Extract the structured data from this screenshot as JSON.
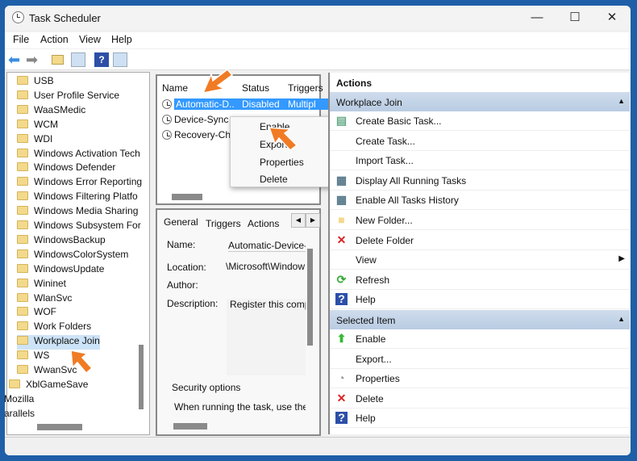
{
  "window": {
    "title": "Task Scheduler",
    "minimize": "—",
    "maximize": "☐",
    "close": "✕"
  },
  "menu": [
    "File",
    "Action",
    "View",
    "Help"
  ],
  "tree": [
    "USB",
    "User Profile Service",
    "WaaSMedic",
    "WCM",
    "WDI",
    "Windows Activation Tech",
    "Windows Defender",
    "Windows Error Reporting",
    "Windows Filtering Platfo",
    "Windows Media Sharing",
    "Windows Subsystem For",
    "WindowsBackup",
    "WindowsColorSystem",
    "WindowsUpdate",
    "Wininet",
    "WlanSvc",
    "WOF",
    "Work Folders",
    "Workplace Join",
    "WS",
    "WwanSvc",
    "XblGameSave",
    "Mozilla",
    "arallels"
  ],
  "tree_selected": "Workplace Join",
  "tasks": {
    "columns": [
      "Name",
      "Status",
      "Triggers"
    ],
    "rows": [
      {
        "name": "Automatic-D...",
        "status": "Disabled",
        "triggers": "Multipl"
      },
      {
        "name": "Device-Sync",
        "status": "",
        "triggers": ""
      },
      {
        "name": "Recovery-Ch",
        "status": "",
        "triggers": ""
      }
    ]
  },
  "context_menu": [
    "Enable",
    "Export...",
    "Properties",
    "Delete"
  ],
  "details": {
    "tabs": [
      "General",
      "Triggers",
      "Actions"
    ],
    "name_label": "Name:",
    "name_value": "Automatic-Device-",
    "location_label": "Location:",
    "location_value": "\\Microsoft\\Window",
    "author_label": "Author:",
    "description_label": "Description:",
    "description_value": "Register this comp",
    "security_label": "Security options",
    "security_text": "When running the task, use the"
  },
  "actions": {
    "title": "Actions",
    "section1": "Workplace Join",
    "items1": [
      {
        "label": "Create Basic Task...",
        "icon": "create-basic-task-icon"
      },
      {
        "label": "Create Task...",
        "icon": "create-task-icon"
      },
      {
        "label": "Import Task...",
        "icon": "import-icon"
      },
      {
        "label": "Display All Running Tasks",
        "icon": "running-tasks-icon"
      },
      {
        "label": "Enable All Tasks History",
        "icon": "history-icon"
      },
      {
        "label": "New Folder...",
        "icon": "folder-icon"
      },
      {
        "label": "Delete Folder",
        "icon": "delete-icon"
      },
      {
        "label": "View",
        "icon": ""
      },
      {
        "label": "Refresh",
        "icon": "refresh-icon"
      },
      {
        "label": "Help",
        "icon": "help-icon"
      }
    ],
    "section2": "Selected Item",
    "items2": [
      {
        "label": "Enable",
        "icon": "enable-arrow-icon"
      },
      {
        "label": "Export...",
        "icon": ""
      },
      {
        "label": "Properties",
        "icon": "properties-icon"
      },
      {
        "label": "Delete",
        "icon": "delete-icon"
      },
      {
        "label": "Help",
        "icon": "help-icon"
      }
    ]
  },
  "colors": {
    "accent": "#3a6fc4",
    "selection": "#3399ff",
    "arrow": "#f07b24"
  }
}
